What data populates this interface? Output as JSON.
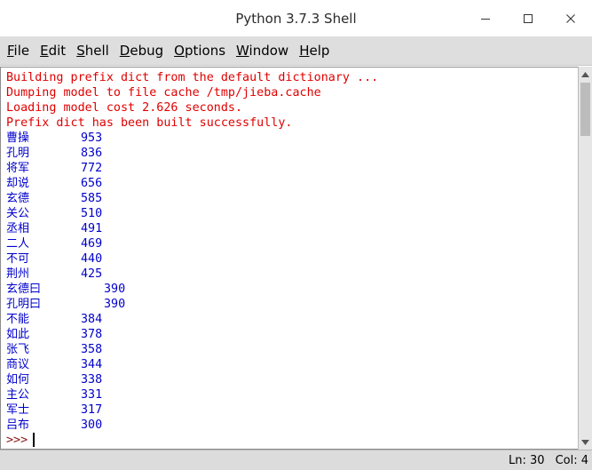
{
  "window": {
    "title": "Python 3.7.3 Shell"
  },
  "menu": [
    {
      "u": "F",
      "rest": "ile"
    },
    {
      "u": "E",
      "rest": "dit"
    },
    {
      "u": "S",
      "rest": "hell"
    },
    {
      "u": "D",
      "rest": "ebug"
    },
    {
      "u": "O",
      "rest": "ptions"
    },
    {
      "u": "W",
      "rest": "indow"
    },
    {
      "u": "H",
      "rest": "elp"
    }
  ],
  "output": {
    "stderr": [
      "Building prefix dict from the default dictionary ...",
      "Dumping model to file cache /tmp/jieba.cache",
      "Loading model cost 2.626 seconds.",
      "Prefix dict has been built successfully."
    ],
    "rows": [
      {
        "word": "曹操",
        "count": "953"
      },
      {
        "word": "孔明",
        "count": "836"
      },
      {
        "word": "将军",
        "count": "772"
      },
      {
        "word": "却说",
        "count": "656"
      },
      {
        "word": "玄德",
        "count": "585"
      },
      {
        "word": "关公",
        "count": "510"
      },
      {
        "word": "丞相",
        "count": "491"
      },
      {
        "word": "二人",
        "count": "469"
      },
      {
        "word": "不可",
        "count": "440"
      },
      {
        "word": "荆州",
        "count": "425"
      },
      {
        "word": "玄德曰",
        "count": "390"
      },
      {
        "word": "孔明曰",
        "count": "390"
      },
      {
        "word": "不能",
        "count": "384"
      },
      {
        "word": "如此",
        "count": "378"
      },
      {
        "word": "张飞",
        "count": "358"
      },
      {
        "word": "商议",
        "count": "344"
      },
      {
        "word": "如何",
        "count": "338"
      },
      {
        "word": "主公",
        "count": "331"
      },
      {
        "word": "军士",
        "count": "317"
      },
      {
        "word": "吕布",
        "count": "300"
      }
    ],
    "prompt": ">>>"
  },
  "status": {
    "line": "Ln: 30",
    "col": "Col: 4"
  }
}
